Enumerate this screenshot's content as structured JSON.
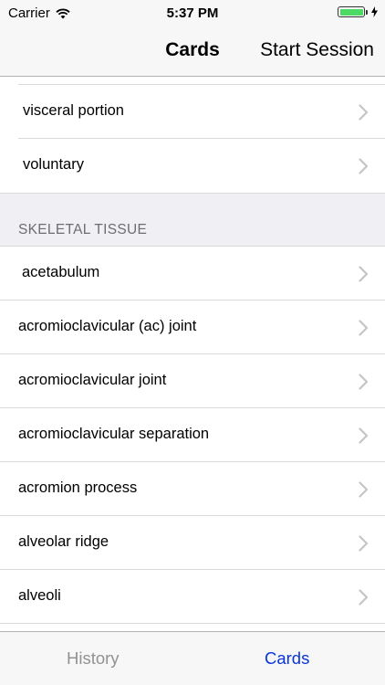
{
  "status": {
    "carrier": "Carrier",
    "time": "5:37 PM"
  },
  "nav": {
    "title": "Cards",
    "action": "Start Session"
  },
  "list": {
    "top_items": [
      "visceral portion",
      "voluntary"
    ],
    "section_title": "SKELETAL TISSUE",
    "section_items": [
      "acetabulum",
      "acromioclavicular (ac) joint",
      "acromioclavicular joint",
      "acromioclavicular separation",
      "acromion process",
      "alveolar ridge",
      "alveoli"
    ]
  },
  "tabs": {
    "history": "History",
    "cards": "Cards",
    "active": "Cards"
  },
  "colors": {
    "tint": "#0a35d8",
    "battery": "#4cd964"
  },
  "icons": {
    "wifi": "wifi-icon",
    "battery": "battery-icon",
    "charging": "charging-bolt-icon",
    "chevron": "chevron-right-icon"
  }
}
